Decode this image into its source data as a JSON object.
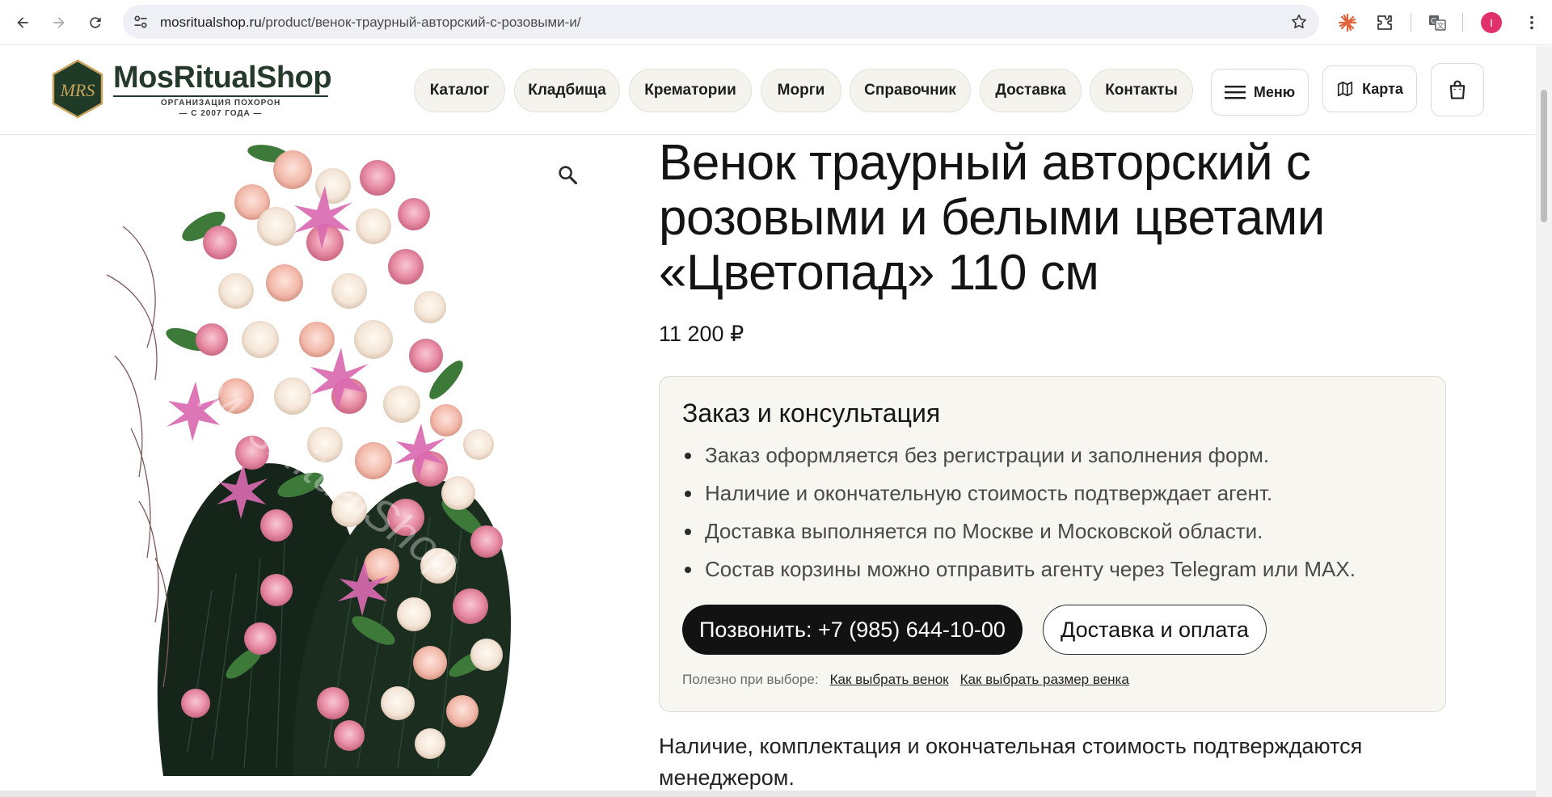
{
  "browser": {
    "url_host": "mosritualshop.ru",
    "url_path": "/product/венок-траурный-авторский-с-розовыми-и/",
    "profile_initial": "I",
    "icons": [
      "back-icon",
      "forward-icon",
      "reload-icon",
      "site-info-icon",
      "bookmark-star-icon",
      "extension-burst-icon",
      "extensions-puzzle-icon",
      "translate-icon",
      "more-vert-icon"
    ]
  },
  "header": {
    "logo_name": "MosRitualShop",
    "logo_sub1": "ОРГАНИЗАЦИЯ ПОХОРОН",
    "logo_sub2": "— С 2007 ГОДА —",
    "logo_monogram": "MRS",
    "nav": [
      "Каталог",
      "Кладбища",
      "Крематории",
      "Морги",
      "Справочник",
      "Доставка",
      "Контакты"
    ],
    "menu_label": "Меню",
    "map_label": "Карта"
  },
  "product": {
    "title": "Венок траурный авторский с розовыми и белыми цветами «Цветопад» 110 см",
    "price": "11 200 ₽",
    "watermark": "MosRitualShop"
  },
  "order": {
    "title": "Заказ и консультация",
    "items": [
      "Заказ оформляется без регистрации и заполнения форм.",
      "Наличие и окончательную стоимость подтверждает агент.",
      "Доставка выполняется по Москве и Московской области.",
      "Состав корзины можно отправить агенту через Telegram или MAX."
    ],
    "call_button": "Позвонить: +7 (985) 644-10-00",
    "delivery_button": "Доставка и оплата",
    "useful_label": "Полезно при выборе:",
    "links": [
      "Как выбрать венок",
      "Как выбрать размер венка"
    ]
  },
  "note": "Наличие, комплектация и окончательная стоимость подтверждаются менеджером.",
  "colors": {
    "brand_green": "#263a2b",
    "logo_gold": "#c9a45a",
    "button_dark": "#121212",
    "box_bg": "#f7f6f1",
    "pill_bg": "#f4f3ee",
    "profile": "#e0316b"
  }
}
